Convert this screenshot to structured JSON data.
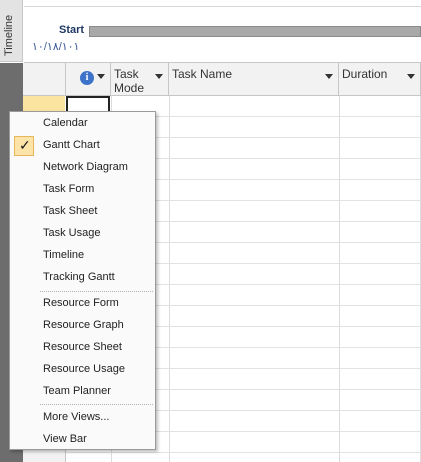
{
  "timeline": {
    "side_label": "Timeline",
    "start_label": "Start",
    "start_date": "١٠/١٨/١٠١"
  },
  "grid": {
    "headers": {
      "info": "i",
      "task_mode": "Task\nMode",
      "task_name": "Task Name",
      "duration": "Duration"
    }
  },
  "menu": {
    "items": [
      {
        "label": "Calendar",
        "checked": false
      },
      {
        "label": "Gantt Chart",
        "checked": true
      },
      {
        "label": "Network Diagram",
        "checked": false
      },
      {
        "label": "Task Form",
        "checked": false
      },
      {
        "label": "Task Sheet",
        "checked": false
      },
      {
        "label": "Task Usage",
        "checked": false
      },
      {
        "label": "Timeline",
        "checked": false
      },
      {
        "label": "Tracking Gantt",
        "checked": false
      },
      {
        "label": "Resource Form",
        "checked": false
      },
      {
        "label": "Resource Graph",
        "checked": false
      },
      {
        "label": "Resource Sheet",
        "checked": false
      },
      {
        "label": "Resource Usage",
        "checked": false
      },
      {
        "label": "Team Planner",
        "checked": false
      },
      {
        "label": "More Views...",
        "checked": false
      },
      {
        "label": "View Bar",
        "checked": false
      }
    ],
    "check_glyph": "✓"
  }
}
